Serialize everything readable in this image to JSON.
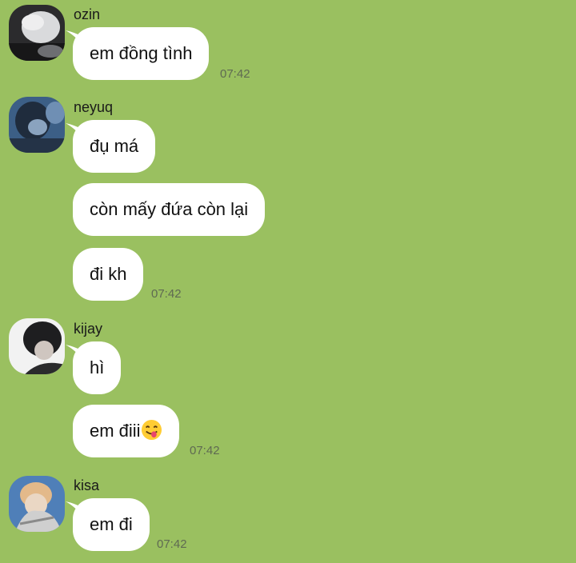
{
  "messages": [
    {
      "sender": "ozin",
      "bubbles": [
        "em đồng tình"
      ],
      "time": "07:42"
    },
    {
      "sender": "neyuq",
      "bubbles": [
        "đụ má",
        "còn mấy đứa còn lại",
        "đi kh"
      ],
      "time": "07:42"
    },
    {
      "sender": "kijay",
      "bubbles": [
        "hì",
        "em điii"
      ],
      "emoji": "face-savoring-food-emoji",
      "time": "07:42"
    },
    {
      "sender": "kisa",
      "bubbles": [
        "em đi"
      ],
      "time": "07:42"
    }
  ],
  "colors": {
    "background": "#9ac060",
    "bubble": "#ffffff",
    "timestamp": "#5f6a52"
  }
}
